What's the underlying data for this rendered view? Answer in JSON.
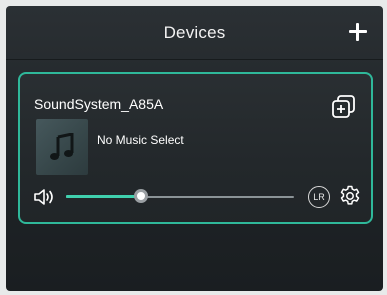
{
  "header": {
    "title": "Devices",
    "add_icon": "plus-icon"
  },
  "device_card": {
    "name": "SoundSystem_A85A",
    "group_icon": "group-copy-icon",
    "album_art_icon": "music-note-icon",
    "song_title": "No Music Select",
    "volume_icon": "speaker-icon",
    "volume_level_fraction": 0.33,
    "channel_label": "LR",
    "settings_icon": "gear-icon"
  },
  "colors": {
    "accent": "#2fb89a",
    "slider_fill": "#40d0ae",
    "background": "#1f2427"
  }
}
